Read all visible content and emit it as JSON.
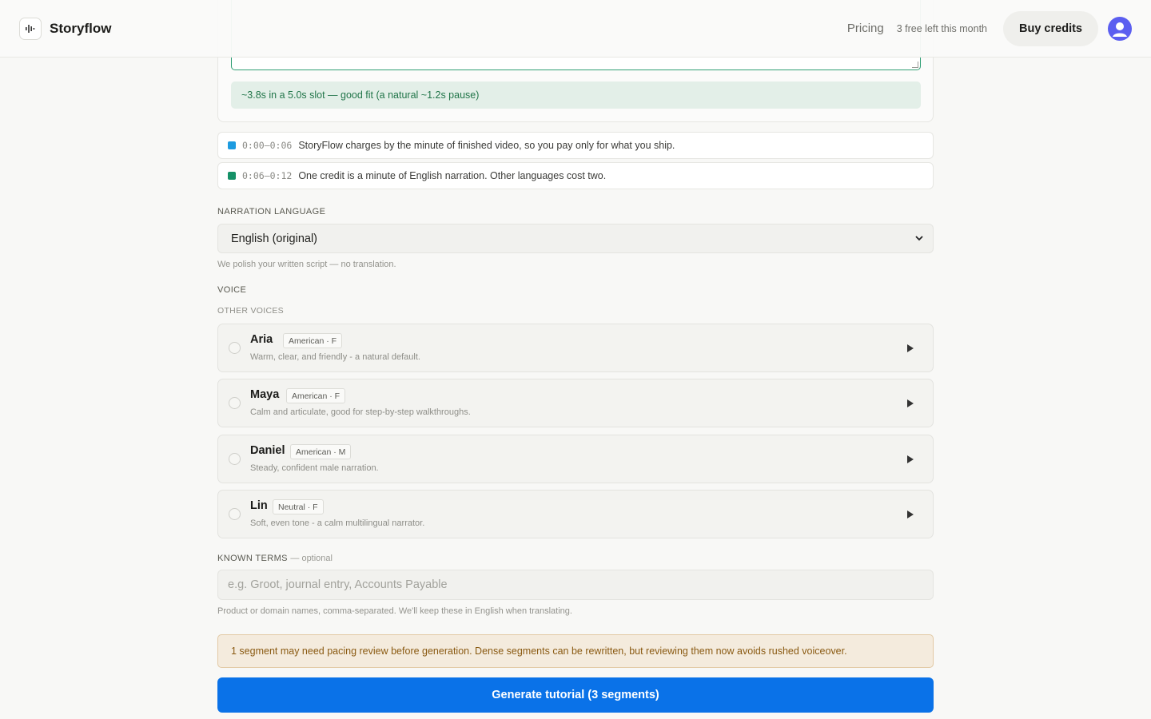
{
  "header": {
    "brand_name": "Storyflow",
    "pricing_label": "Pricing",
    "free_left": "3 free left this month",
    "buy_credits_label": "Buy credits"
  },
  "segment_editor": {
    "pace_status": "~3.8s in a 5.0s slot — good fit (a natural ~1.2s pause)"
  },
  "segments": [
    {
      "time": "0:00–0:06",
      "text": "StoryFlow charges by the minute of finished video, so you pay only for what you ship.",
      "color": "#1d9be0"
    },
    {
      "time": "0:06–0:12",
      "text": "One credit is a minute of English narration. Other languages cost two.",
      "color": "#159167"
    }
  ],
  "narration_language": {
    "label": "NARRATION LANGUAGE",
    "selected": "English (original)",
    "hint": "We polish your written script — no translation."
  },
  "voice": {
    "label": "VOICE",
    "group_label": "OTHER VOICES",
    "options": [
      {
        "name": "Aria",
        "tag": "American · F",
        "description": "Warm, clear, and friendly - a natural default."
      },
      {
        "name": "Maya",
        "tag": "American · F",
        "description": "Calm and articulate, good for step-by-step walkthroughs."
      },
      {
        "name": "Daniel",
        "tag": "American · M",
        "description": "Steady, confident male narration."
      },
      {
        "name": "Lin",
        "tag": "Neutral · F",
        "description": "Soft, even tone - a calm multilingual narrator."
      }
    ]
  },
  "known_terms": {
    "label": "KNOWN TERMS",
    "optional": "— optional",
    "placeholder": "e.g. Groot, journal entry, Accounts Payable",
    "hint": "Product or domain names, comma-separated. We'll keep these in English when translating."
  },
  "warning": "1 segment may need pacing review before generation. Dense segments can be rewritten, but reviewing them now avoids rushed voiceover.",
  "generate_label": "Generate tutorial (3 segments)",
  "colors": {
    "accent": "#0a72e8",
    "avatar": "#5b5ef0",
    "success": "#217549",
    "warning": "#8a5a12"
  }
}
